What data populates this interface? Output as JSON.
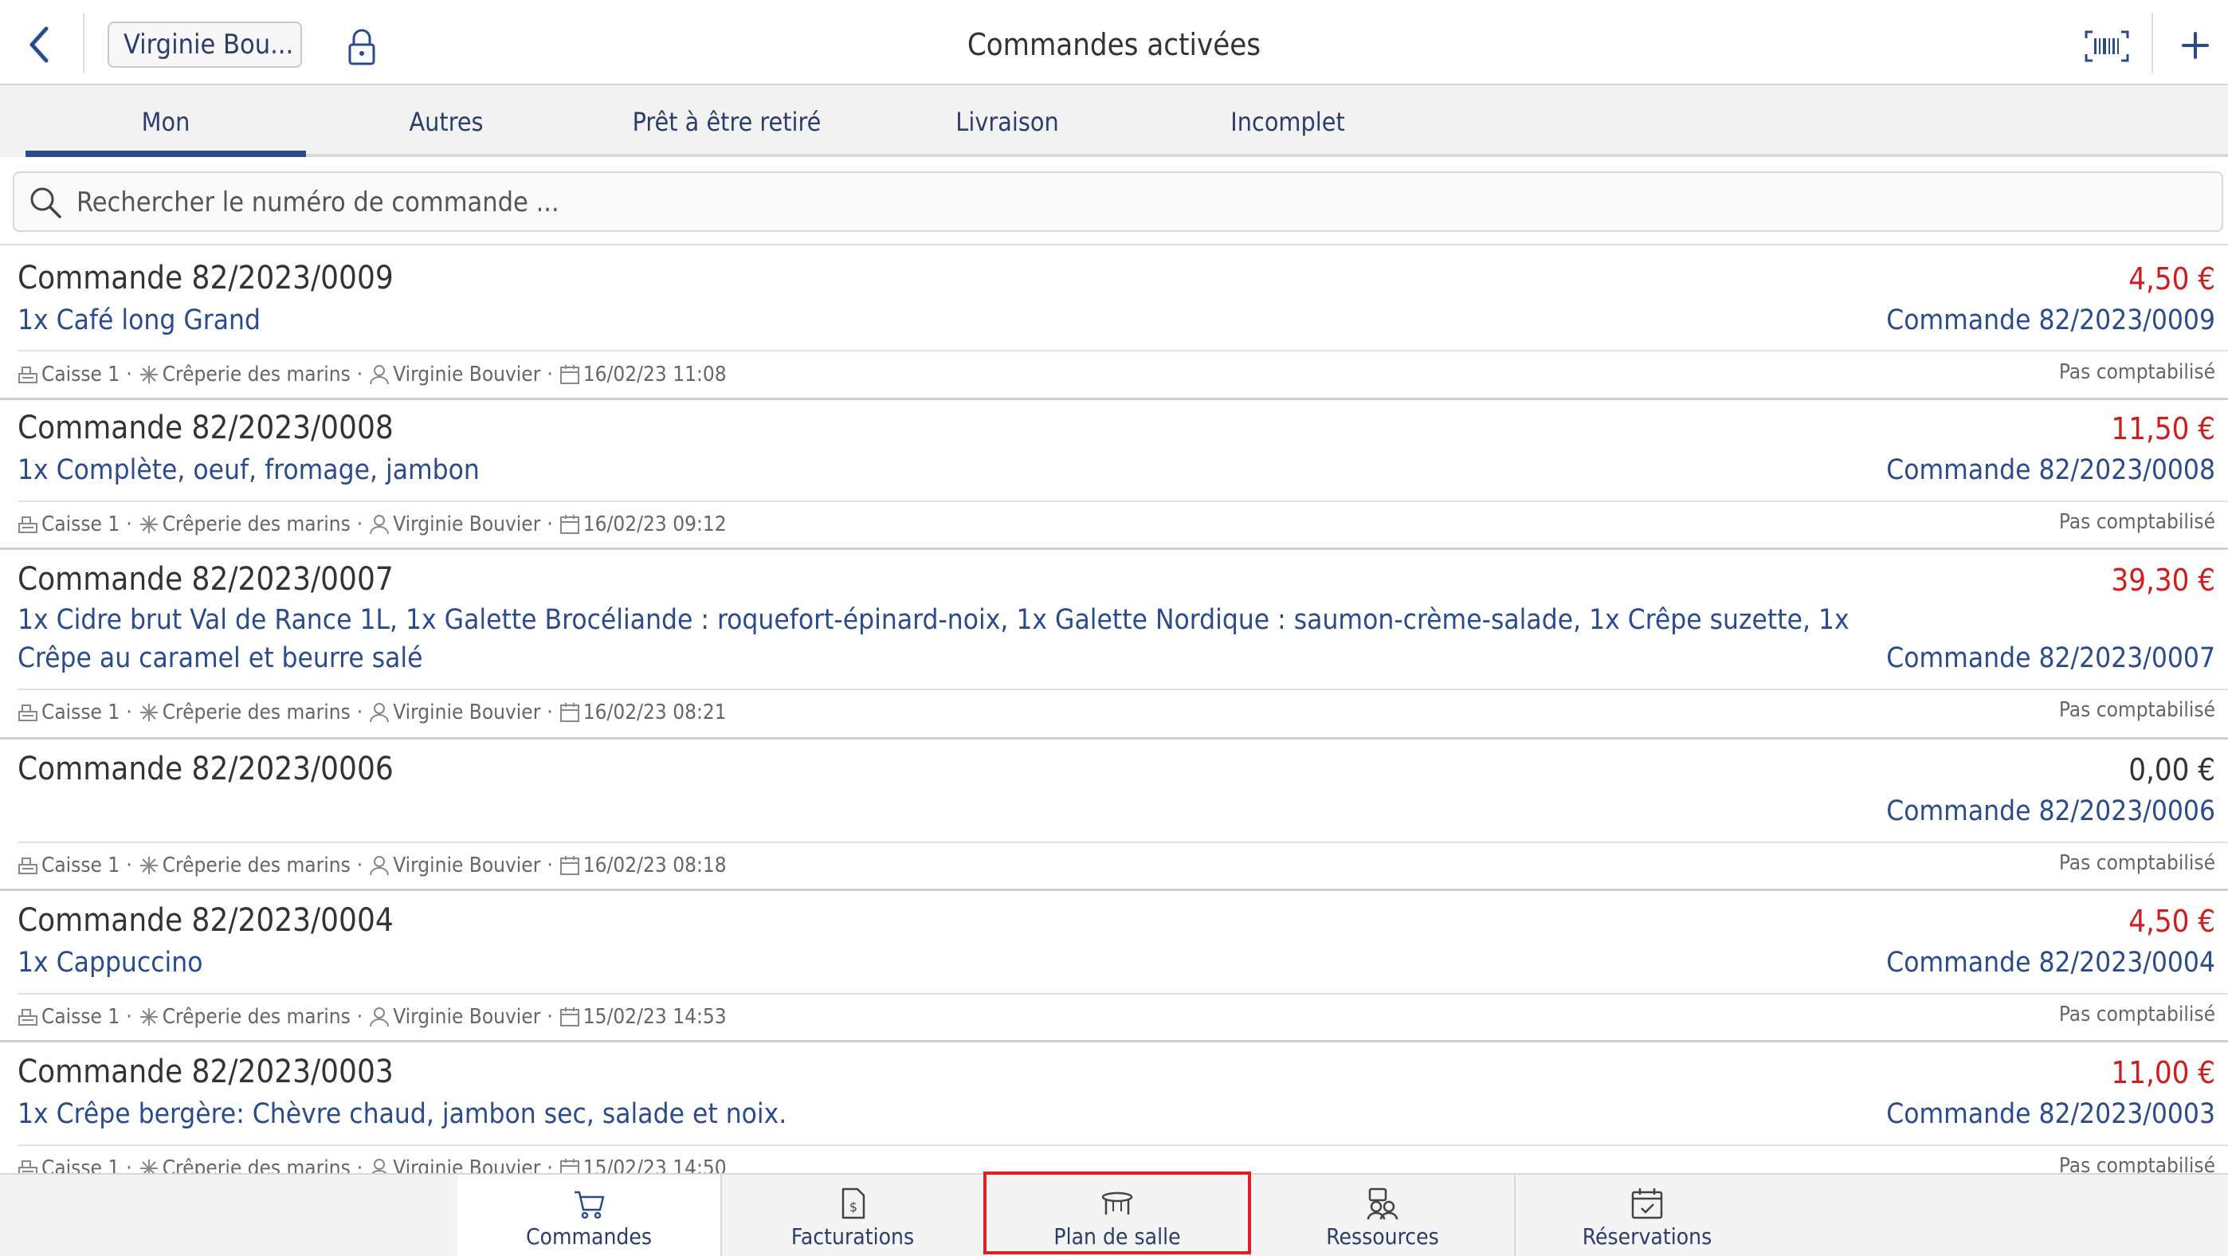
{
  "header": {
    "user_button": "Virginie Bou...",
    "title": "Commandes activées"
  },
  "tabs": [
    {
      "label": "Mon",
      "active": true
    },
    {
      "label": "Autres"
    },
    {
      "label": "Prêt à être retiré"
    },
    {
      "label": "Livraison"
    },
    {
      "label": "Incomplet"
    }
  ],
  "search": {
    "placeholder": "Rechercher le numéro de commande ..."
  },
  "orders": [
    {
      "title": "Commande 82/2023/0009",
      "price": "4,50 €",
      "desc": "1x Café long Grand",
      "ref": "Commande 82/2023/0009",
      "register": "Caisse 1",
      "shop": "Crêperie des marins",
      "user": "Virginie Bouvier",
      "date": "16/02/23 11:08",
      "status": "Pas comptabilisé"
    },
    {
      "title": "Commande 82/2023/0008",
      "price": "11,50 €",
      "desc": "1x Complète, oeuf, fromage, jambon",
      "ref": "Commande 82/2023/0008",
      "register": "Caisse 1",
      "shop": "Crêperie des marins",
      "user": "Virginie Bouvier",
      "date": "16/02/23 09:12",
      "status": "Pas comptabilisé"
    },
    {
      "title": "Commande 82/2023/0007",
      "price": "39,30 €",
      "desc": "1x Cidre brut Val de Rance 1L, 1x Galette Brocéliande : roquefort-épinard-noix, 1x Galette Nordique : saumon-crème-salade, 1x Crêpe suzette, 1x Crêpe au caramel et beurre salé",
      "ref": "Commande 82/2023/0007",
      "register": "Caisse 1",
      "shop": "Crêperie des marins",
      "user": "Virginie Bouvier",
      "date": "16/02/23 08:21",
      "status": "Pas comptabilisé"
    },
    {
      "title": "Commande 82/2023/0006",
      "price": "0,00 €",
      "desc": "",
      "ref": "Commande 82/2023/0006",
      "register": "Caisse 1",
      "shop": "Crêperie des marins",
      "user": "Virginie Bouvier",
      "date": "16/02/23 08:18",
      "status": "Pas comptabilisé"
    },
    {
      "title": "Commande 82/2023/0004",
      "price": "4,50 €",
      "desc": "1x Cappuccino",
      "ref": "Commande 82/2023/0004",
      "register": "Caisse 1",
      "shop": "Crêperie des marins",
      "user": "Virginie Bouvier",
      "date": "15/02/23 14:53",
      "status": "Pas comptabilisé"
    },
    {
      "title": "Commande 82/2023/0003",
      "price": "11,00 €",
      "desc": "1x Crêpe bergère: Chèvre chaud, jambon sec, salade et noix.",
      "ref": "Commande 82/2023/0003",
      "register": "Caisse 1",
      "shop": "Crêperie des marins",
      "user": "Virginie Bouvier",
      "date": "15/02/23 14:50",
      "status": "Pas comptabilisé"
    }
  ],
  "bottom_nav": [
    {
      "label": "Commandes",
      "icon": "cart-icon",
      "active": true
    },
    {
      "label": "Facturations",
      "icon": "invoice-icon"
    },
    {
      "label": "Plan de salle",
      "icon": "table-icon",
      "highlighted": true
    },
    {
      "label": "Ressources",
      "icon": "resources-icon"
    },
    {
      "label": "Réservations",
      "icon": "calendar-check-icon"
    }
  ],
  "colors": {
    "accent": "#2b4b8f",
    "price": "#d01c1c",
    "highlight": "#e02020"
  }
}
